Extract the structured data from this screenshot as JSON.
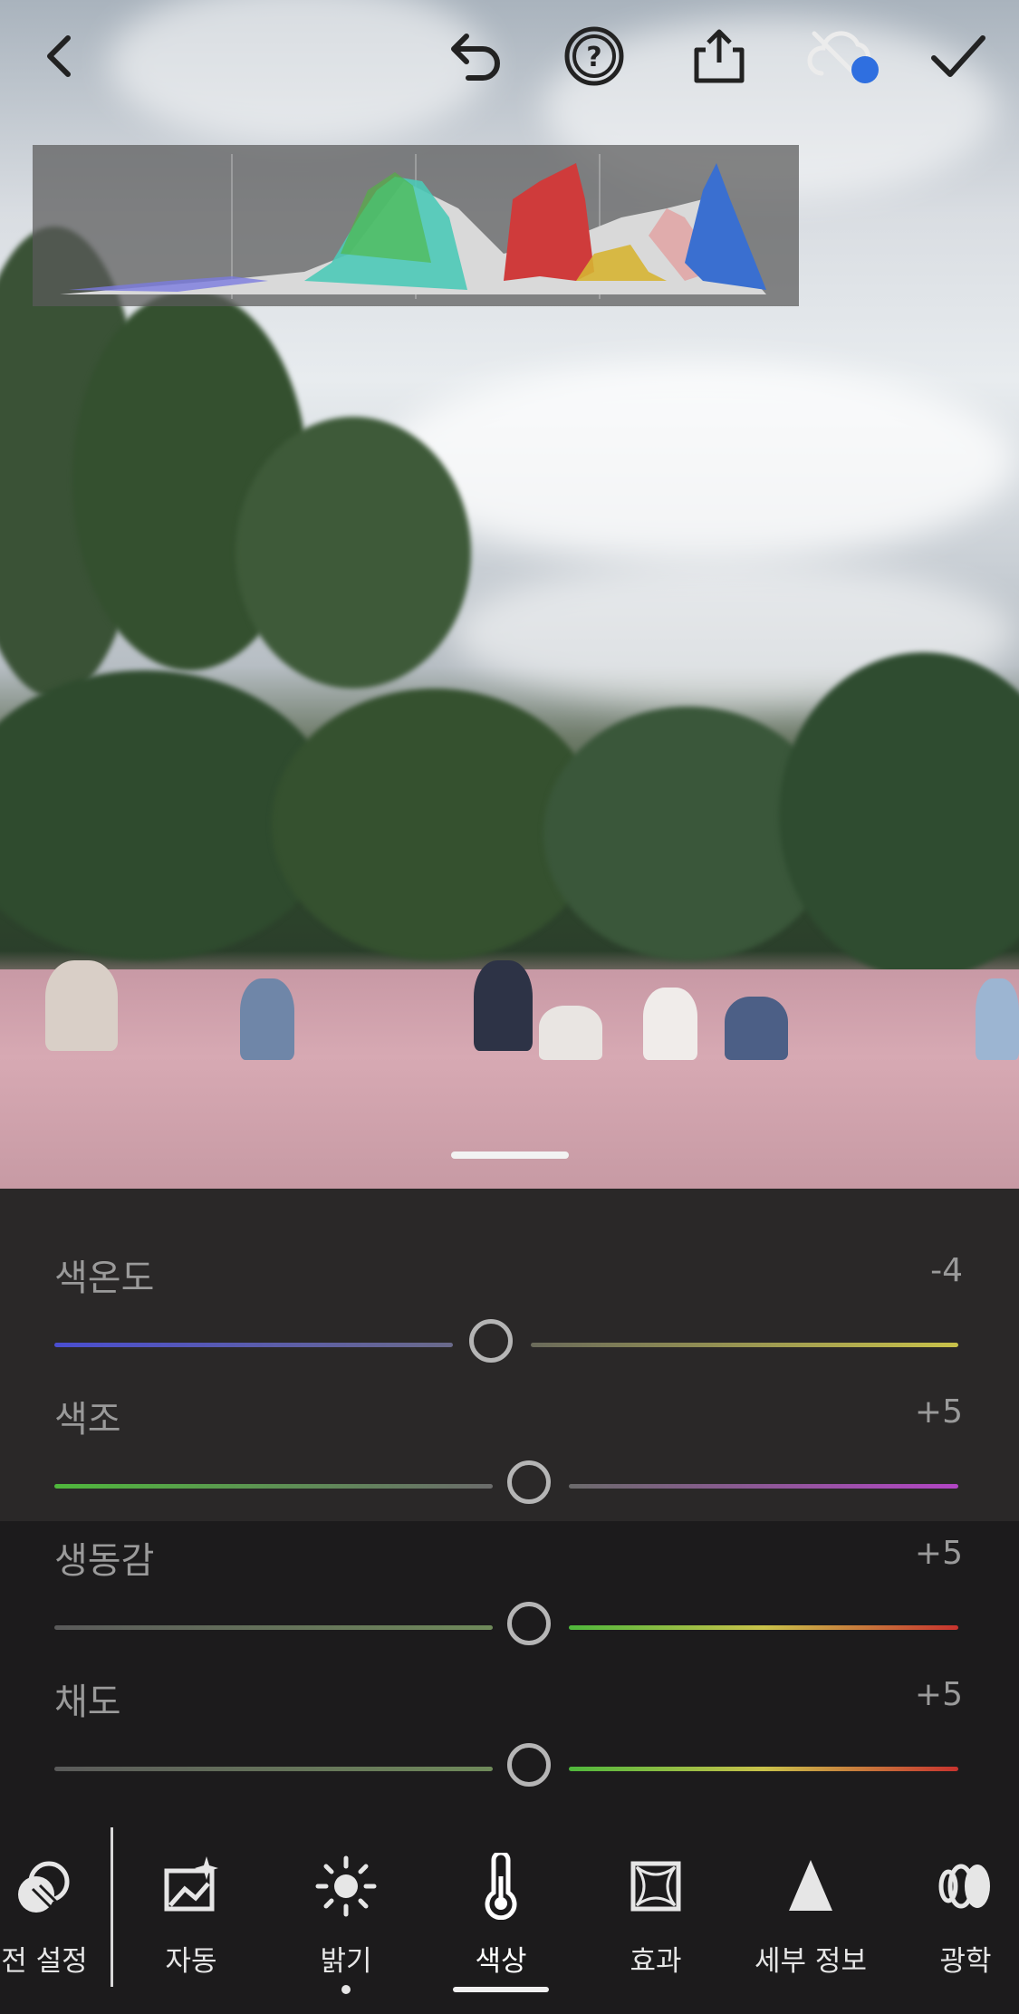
{
  "topbar": {
    "icons": [
      "back-icon",
      "undo-icon",
      "help-icon",
      "share-icon",
      "cloud-sync-icon",
      "confirm-check-icon"
    ],
    "accent": "#2f6fe0"
  },
  "sliders": [
    {
      "label": "색온도",
      "value": "-4",
      "position": 0.481,
      "left_color": "#4a4ed1",
      "right_color": "#c9c24a"
    },
    {
      "label": "색조",
      "value": "+5",
      "position": 0.524,
      "left_color": "#4fb83c",
      "right_color": "#b245c4"
    },
    {
      "label": "생동감",
      "value": "+5",
      "position": 0.524,
      "left_color": "#6b6b6b",
      "right_color": "#c8332e"
    },
    {
      "label": "채도",
      "value": "+5",
      "position": 0.524,
      "left_color": "#6b6b6b",
      "right_color": "#c8332e"
    }
  ],
  "toolbar": {
    "items": [
      {
        "label": "전 설정",
        "icon": "presets-icon"
      },
      {
        "label": "자동",
        "icon": "auto-enhance-icon"
      },
      {
        "label": "밝기",
        "icon": "brightness-sun-icon"
      },
      {
        "label": "색상",
        "icon": "color-thermometer-icon"
      },
      {
        "label": "효과",
        "icon": "effects-vignette-icon"
      },
      {
        "label": "세부 정보",
        "icon": "detail-triangle-icon"
      },
      {
        "label": "광학",
        "icon": "optics-lens-icon"
      }
    ],
    "active": "색상"
  }
}
